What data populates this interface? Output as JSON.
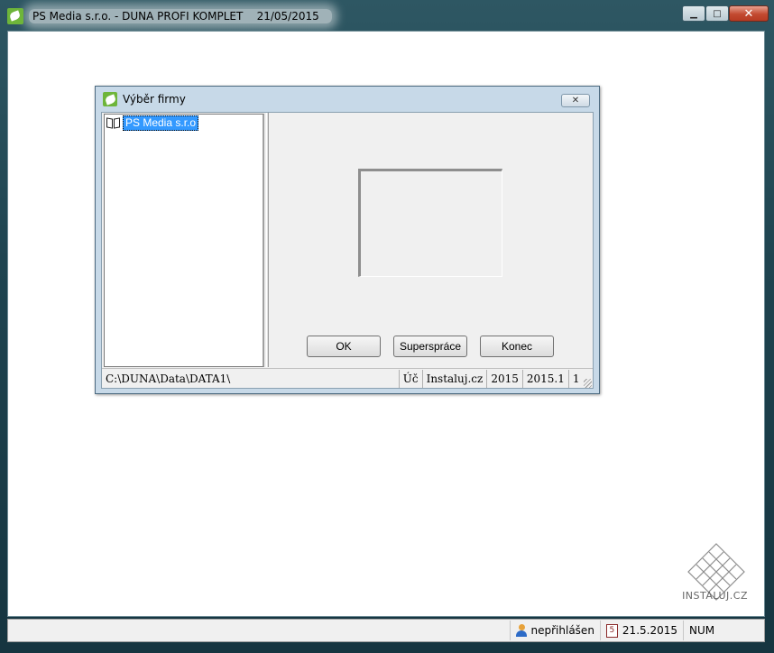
{
  "window": {
    "title": "PS Media s.r.o. - DUNA PROFI KOMPLET",
    "date": "21/05/2015",
    "minimize_symbol": "▁",
    "maximize_symbol": "□",
    "close_symbol": "✕"
  },
  "dialog": {
    "title": "Výběr firmy",
    "close_symbol": "✕",
    "tree": {
      "items": [
        {
          "label": "PS Media s.r.o",
          "icon": "book-icon",
          "selected": true
        }
      ]
    },
    "buttons": {
      "ok": "OK",
      "superspravce": "Superspráce",
      "konec": "Konec"
    },
    "status": {
      "path": "C:\\DUNA\\Data\\DATA1\\",
      "type": "Úč",
      "user": "Instaluj.cz",
      "year": "2015",
      "version": "2015.1",
      "number": "1"
    }
  },
  "statusbar": {
    "login": "nepřihlášen",
    "date": "21.5.2015",
    "num": "NUM"
  },
  "watermark": {
    "text": "INSTALUJ.CZ"
  }
}
